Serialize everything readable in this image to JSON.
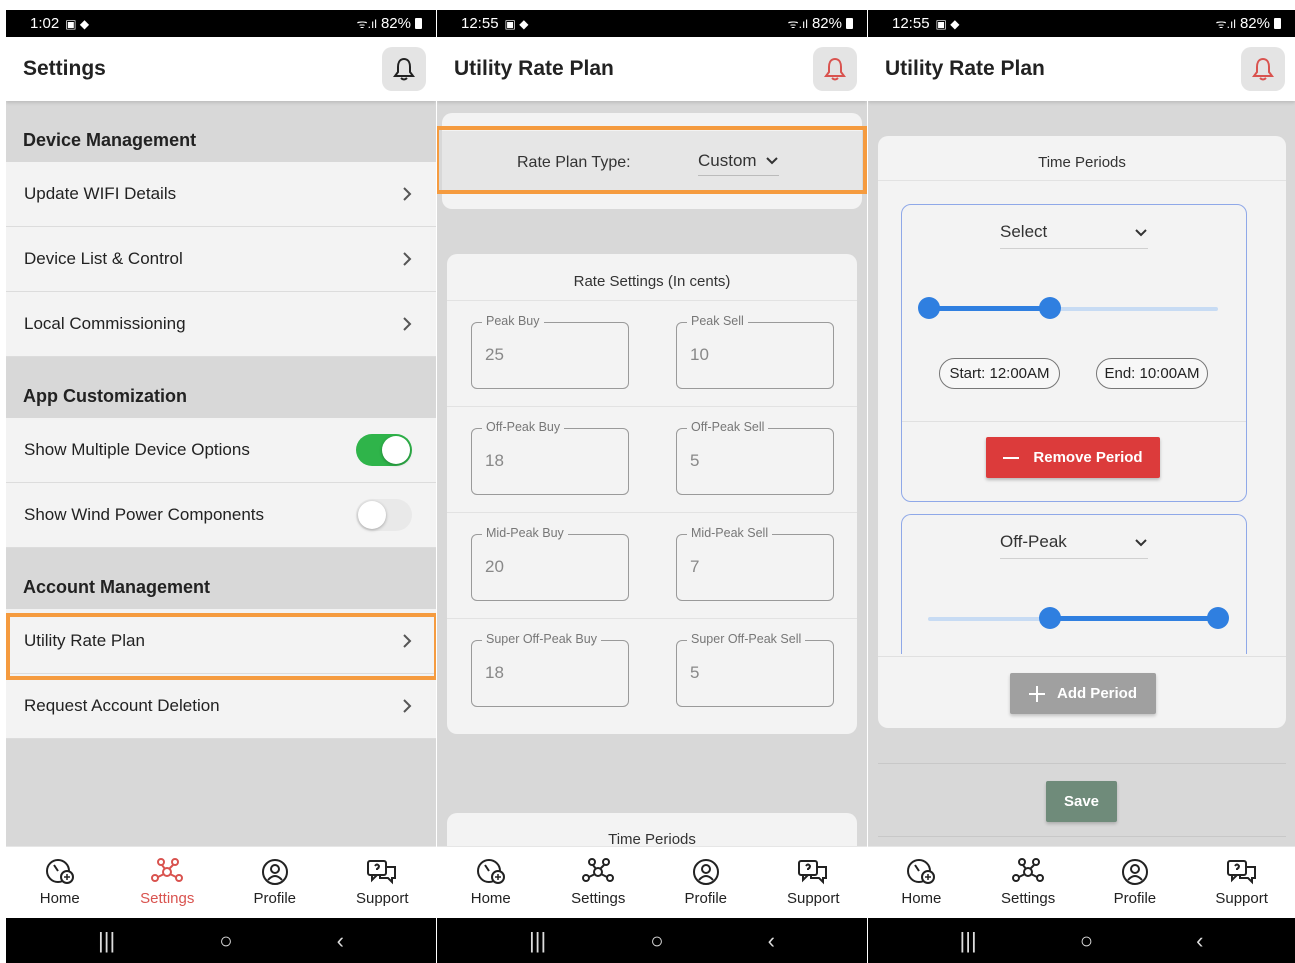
{
  "status": {
    "p1_time": "1:02",
    "p2_time": "12:55",
    "p3_time": "12:55",
    "battery": "82%"
  },
  "panel1": {
    "title": "Settings",
    "device_header": "Device Management",
    "items_device": [
      "Update WIFI Details",
      "Device List & Control",
      "Local Commissioning"
    ],
    "app_header": "App Customization",
    "toggle_multi": "Show Multiple Device Options",
    "toggle_multi_on": true,
    "toggle_wind": "Show Wind Power Components",
    "toggle_wind_on": false,
    "account_header": "Account Management",
    "items_account": [
      "Utility Rate Plan",
      "Request Account Deletion"
    ]
  },
  "panel2": {
    "title": "Utility Rate Plan",
    "rate_plan_label": "Rate Plan Type:",
    "rate_plan_value": "Custom",
    "rate_settings_title": "Rate Settings (In cents)",
    "fields": [
      {
        "buy_label": "Peak Buy",
        "buy_value": "25",
        "sell_label": "Peak Sell",
        "sell_value": "10"
      },
      {
        "buy_label": "Off-Peak Buy",
        "buy_value": "18",
        "sell_label": "Off-Peak Sell",
        "sell_value": "5"
      },
      {
        "buy_label": "Mid-Peak Buy",
        "buy_value": "20",
        "sell_label": "Mid-Peak Sell",
        "sell_value": "7"
      },
      {
        "buy_label": "Super Off-Peak Buy",
        "buy_value": "18",
        "sell_label": "Super Off-Peak Sell",
        "sell_value": "5"
      }
    ],
    "time_periods_title": "Time Periods"
  },
  "panel3": {
    "title": "Utility Rate Plan",
    "time_periods_title": "Time Periods",
    "period1_select": "Select",
    "period1_start": "Start: 12:00AM",
    "period1_end": "End: 10:00AM",
    "remove_label": "Remove Period",
    "period2_select": "Off-Peak",
    "add_label": "Add Period",
    "save_label": "Save"
  },
  "nav": {
    "home": "Home",
    "settings": "Settings",
    "profile": "Profile",
    "support": "Support"
  },
  "colors": {
    "highlight": "#f59b3f",
    "active_nav": "#d9534f",
    "toggle_on": "#2fb44a",
    "slider": "#2f7fe0",
    "remove": "#dc3b3b",
    "save": "#6f8b7a"
  }
}
